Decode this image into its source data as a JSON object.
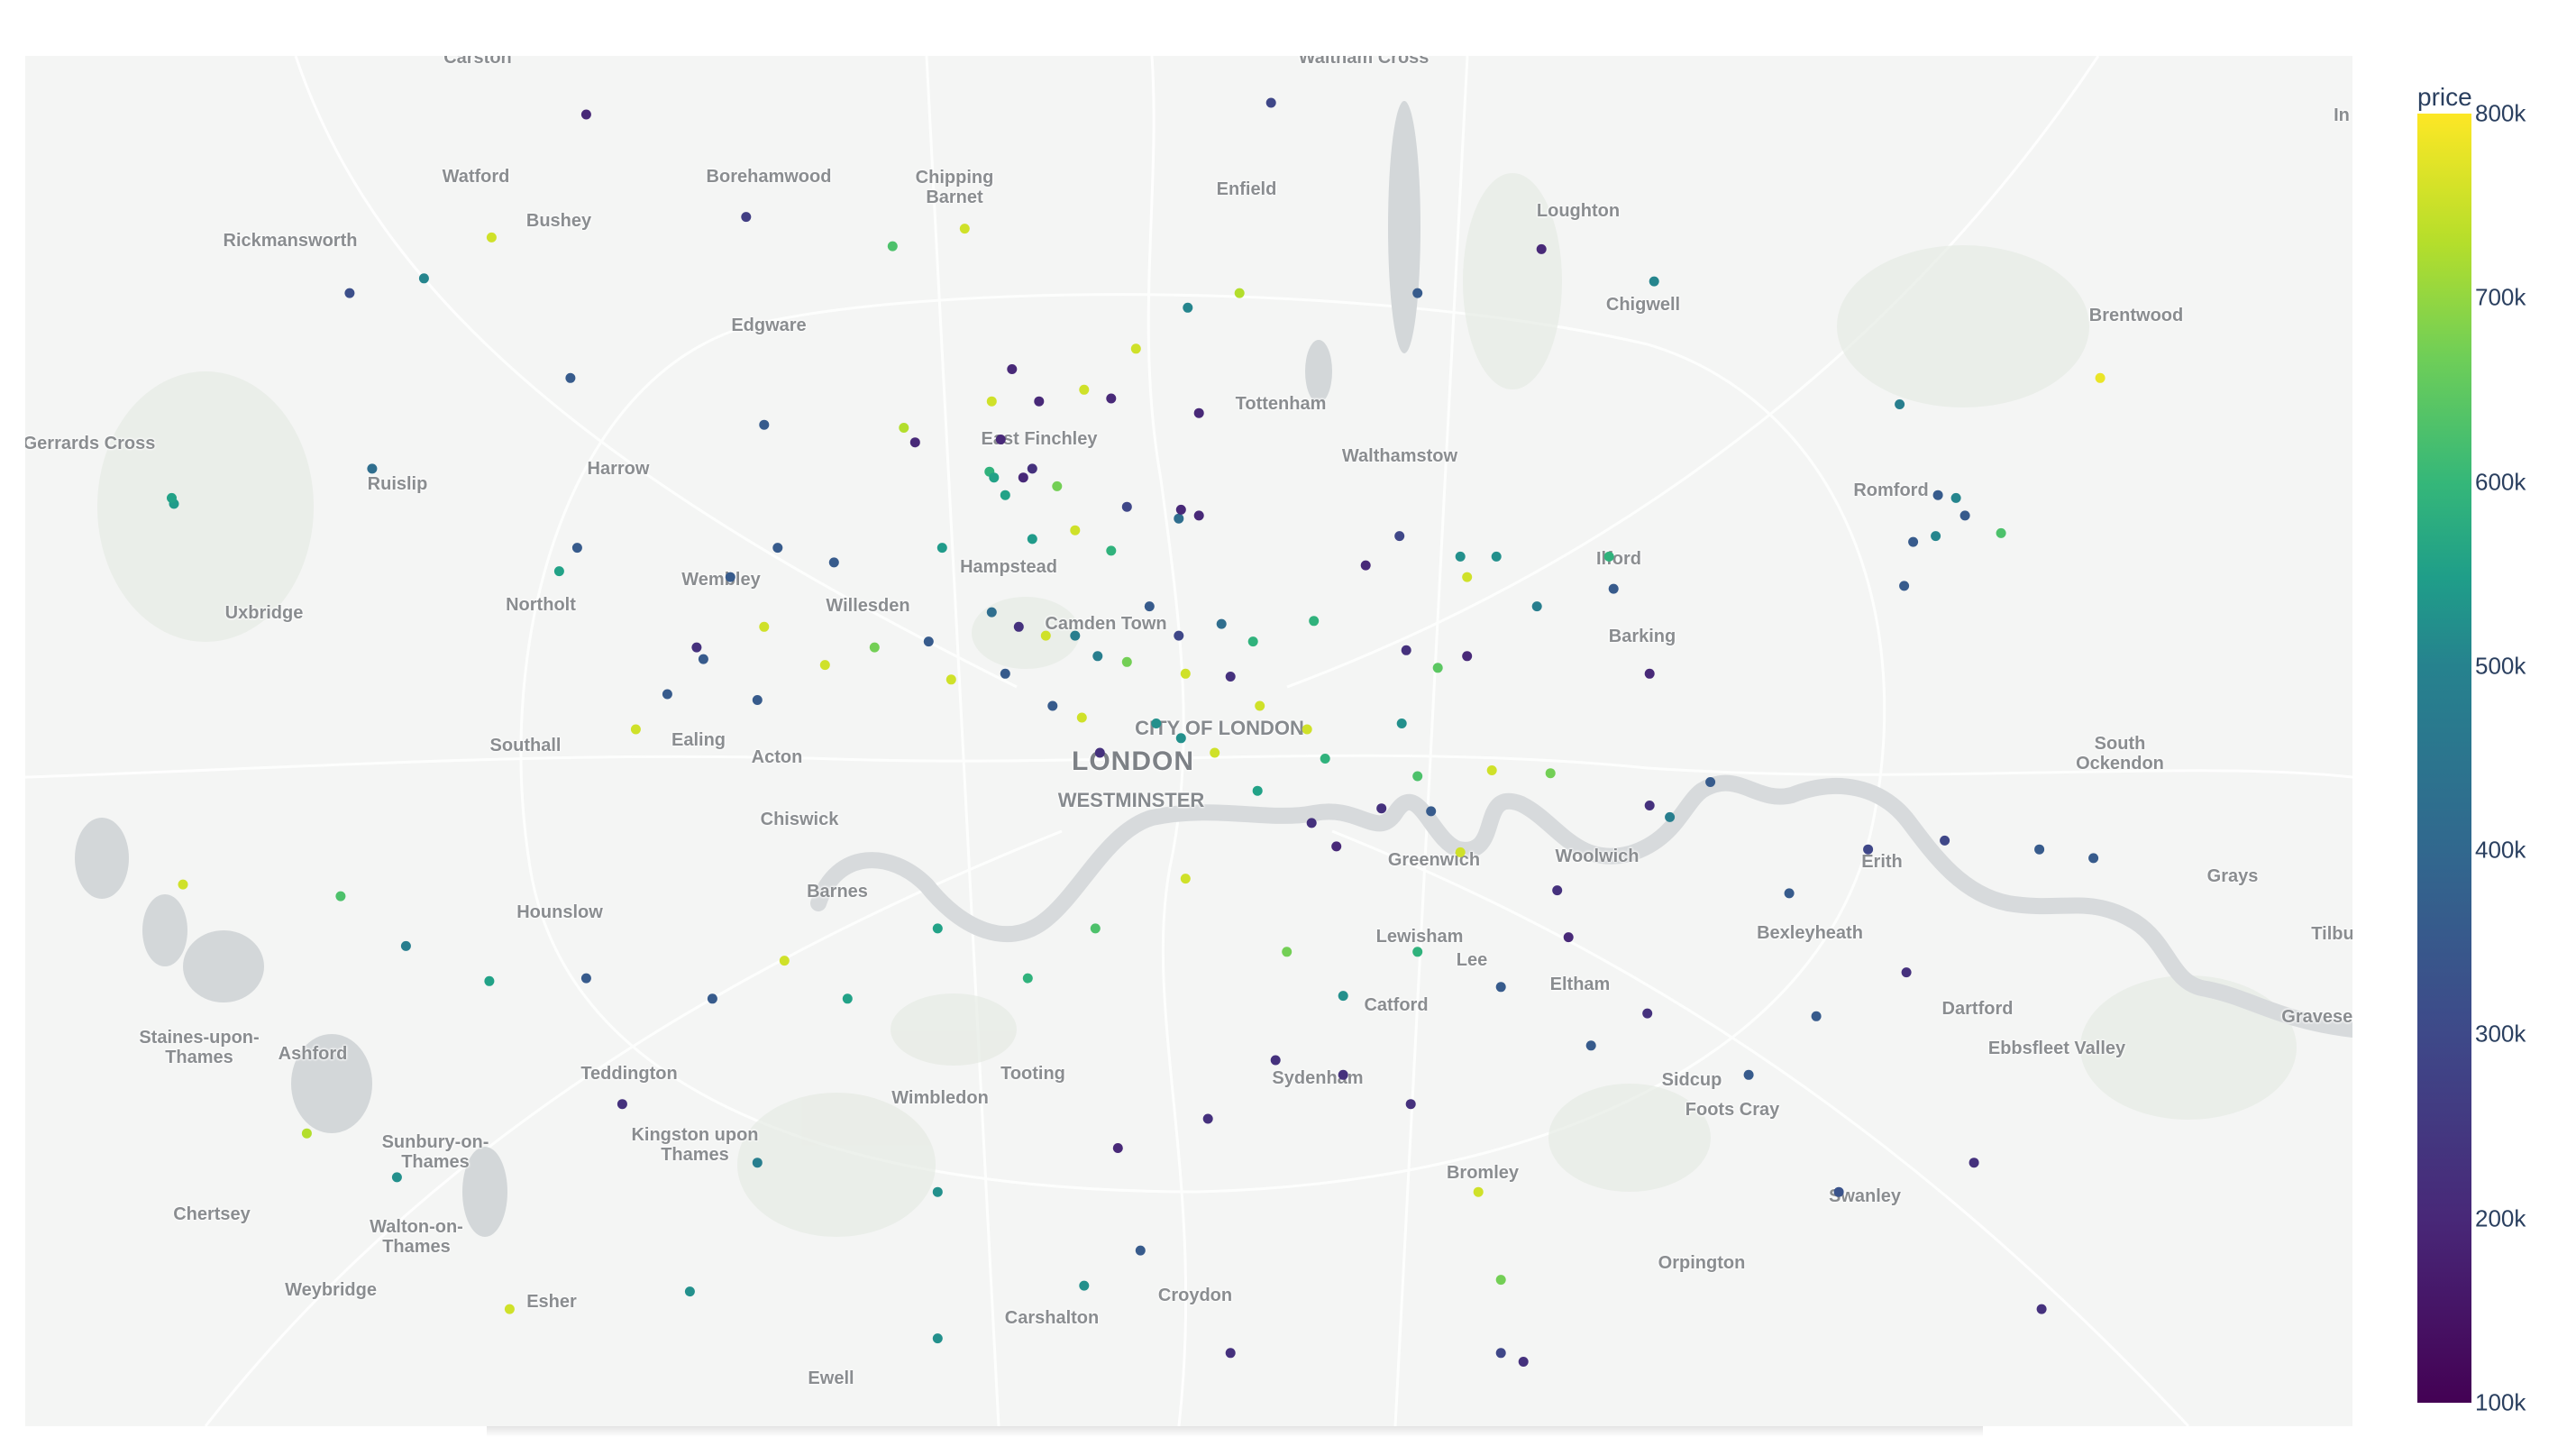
{
  "colorbar": {
    "title": "price",
    "ticks": [
      "800k",
      "700k",
      "600k",
      "500k",
      "400k",
      "300k",
      "200k",
      "100k"
    ],
    "colorscale": [
      "#440154",
      "#482878",
      "#3e4989",
      "#31688e",
      "#26828e",
      "#1f9e89",
      "#35b779",
      "#6ece58",
      "#b5de2b",
      "#fde725"
    ],
    "range": [
      100000,
      800000
    ]
  },
  "map": {
    "water_color": "#d9dcde",
    "land_color": "#f4f5f4",
    "major_label": "LONDON",
    "info_icon": "info-icon",
    "places": [
      "Carston",
      "Waltham Cross",
      "Watford",
      "Borehamwood",
      "Chipping Barnet",
      "Enfield",
      "Loughton",
      "Bushey",
      "Rickmansworth",
      "Chigwell",
      "Edgware",
      "Brentwood",
      "Tottenham",
      "Gerrards Cross",
      "East Finchley",
      "Walthamstow",
      "Romford",
      "Ruislip",
      "Harrow",
      "Hampstead",
      "Ilford",
      "Wembley",
      "Northolt",
      "Willesden",
      "Camden Town",
      "Barking",
      "Uxbridge",
      "CITY OF LONDON",
      "South Ockendon",
      "Southall",
      "Ealing",
      "Acton",
      "WESTMINSTER",
      "Chiswick",
      "Greenwich",
      "Woolwich",
      "Erith",
      "Grays",
      "Barnes",
      "Hounslow",
      "Lewisham",
      "Bexleyheath",
      "Tilbu",
      "Lee",
      "Eltham",
      "Catford",
      "Dartford",
      "Staines-upon-Thames",
      "Ashford",
      "Gravesend",
      "Ebbsfleet Valley",
      "Teddington",
      "Tooting",
      "Sydenham",
      "Sidcup",
      "Wimbledon",
      "Foots Cray",
      "Kingston upon Thames",
      "Sunbury-on-Thames",
      "Bromley",
      "Swanley",
      "Chertsey",
      "Walton-on-Thames",
      "Orpington",
      "Weybridge",
      "Esher",
      "Croydon",
      "Carshalton",
      "Ewell",
      "In"
    ]
  },
  "chart_data": {
    "type": "scatter",
    "title": "",
    "color_variable": "price",
    "color_range": [
      100000,
      800000
    ],
    "points": [
      [
        -0.356,
        51.698,
        180000
      ],
      [
        -0.052,
        51.702,
        250000
      ],
      [
        -0.285,
        51.663,
        230000
      ],
      [
        -0.398,
        51.656,
        750000
      ],
      [
        0.068,
        51.652,
        180000
      ],
      [
        -0.22,
        51.653,
        600000
      ],
      [
        -0.188,
        51.659,
        750000
      ],
      [
        -0.066,
        51.637,
        720000
      ],
      [
        -0.089,
        51.632,
        420000
      ],
      [
        0.013,
        51.637,
        300000
      ],
      [
        0.118,
        51.641,
        420000
      ],
      [
        -0.428,
        51.642,
        420000
      ],
      [
        -0.461,
        51.637,
        270000
      ],
      [
        -0.112,
        51.618,
        750000
      ],
      [
        -0.167,
        51.611,
        180000
      ],
      [
        -0.155,
        51.6,
        180000
      ],
      [
        -0.176,
        51.6,
        750000
      ],
      [
        -0.135,
        51.604,
        750000
      ],
      [
        -0.123,
        51.601,
        180000
      ],
      [
        -0.084,
        51.596,
        180000
      ],
      [
        -0.363,
        51.608,
        300000
      ],
      [
        0.316,
        51.608,
        780000
      ],
      [
        -0.21,
        51.586,
        180000
      ],
      [
        -0.172,
        51.587,
        180000
      ],
      [
        -0.215,
        51.591,
        720000
      ],
      [
        -0.277,
        51.592,
        300000
      ],
      [
        -0.177,
        51.576,
        550000
      ],
      [
        -0.175,
        51.574,
        500000
      ],
      [
        -0.17,
        51.568,
        500000
      ],
      [
        -0.162,
        51.574,
        180000
      ],
      [
        -0.158,
        51.577,
        200000
      ],
      [
        -0.147,
        51.571,
        650000
      ],
      [
        -0.139,
        51.556,
        750000
      ],
      [
        -0.116,
        51.564,
        250000
      ],
      [
        -0.123,
        51.549,
        550000
      ],
      [
        -0.093,
        51.56,
        350000
      ],
      [
        -0.084,
        51.561,
        180000
      ],
      [
        -0.092,
        51.563,
        180000
      ],
      [
        0.227,
        51.599,
        400000
      ],
      [
        0.244,
        51.568,
        300000
      ],
      [
        0.252,
        51.567,
        420000
      ],
      [
        0.256,
        51.561,
        300000
      ],
      [
        0.243,
        51.554,
        420000
      ],
      [
        0.233,
        51.552,
        300000
      ],
      [
        0.229,
        51.537,
        300000
      ],
      [
        0.272,
        51.555,
        600000
      ],
      [
        -0.539,
        51.565,
        480000
      ],
      [
        -0.54,
        51.567,
        500000
      ],
      [
        -0.451,
        51.577,
        350000
      ],
      [
        -0.36,
        51.55,
        300000
      ],
      [
        -0.368,
        51.542,
        500000
      ],
      [
        -0.292,
        51.54,
        300000
      ],
      [
        -0.271,
        51.55,
        300000
      ],
      [
        -0.246,
        51.545,
        300000
      ],
      [
        -0.198,
        51.55,
        480000
      ],
      [
        -0.158,
        51.553,
        480000
      ],
      [
        -0.152,
        51.52,
        750000
      ],
      [
        -0.106,
        51.53,
        300000
      ],
      [
        -0.074,
        51.524,
        350000
      ],
      [
        -0.06,
        51.518,
        550000
      ],
      [
        -0.033,
        51.525,
        550000
      ],
      [
        -0.01,
        51.544,
        180000
      ],
      [
        0.008,
        51.515,
        200000
      ],
      [
        0.022,
        51.509,
        620000
      ],
      [
        0.035,
        51.513,
        180000
      ],
      [
        0.035,
        51.54,
        750000
      ],
      [
        0.005,
        51.554,
        250000
      ],
      [
        0.032,
        51.547,
        450000
      ],
      [
        0.048,
        51.547,
        450000
      ],
      [
        0.066,
        51.53,
        400000
      ],
      [
        0.1,
        51.536,
        300000
      ],
      [
        0.116,
        51.507,
        180000
      ],
      [
        0.098,
        51.547,
        550000
      ],
      [
        -0.176,
        51.528,
        350000
      ],
      [
        -0.164,
        51.523,
        200000
      ],
      [
        -0.139,
        51.52,
        400000
      ],
      [
        -0.129,
        51.513,
        400000
      ],
      [
        -0.116,
        51.511,
        650000
      ],
      [
        -0.09,
        51.507,
        750000
      ],
      [
        -0.07,
        51.506,
        200000
      ],
      [
        -0.093,
        51.52,
        250000
      ],
      [
        -0.057,
        51.496,
        750000
      ],
      [
        -0.036,
        51.488,
        750000
      ],
      [
        -0.028,
        51.478,
        550000
      ],
      [
        0.006,
        51.49,
        450000
      ],
      [
        0.013,
        51.472,
        600000
      ],
      [
        0.046,
        51.474,
        750000
      ],
      [
        0.072,
        51.473,
        650000
      ],
      [
        0.116,
        51.462,
        200000
      ],
      [
        0.143,
        51.47,
        300000
      ],
      [
        -0.277,
        51.523,
        750000
      ],
      [
        -0.304,
        51.512,
        300000
      ],
      [
        -0.32,
        51.5,
        300000
      ],
      [
        -0.334,
        51.488,
        750000
      ],
      [
        -0.307,
        51.516,
        200000
      ],
      [
        -0.28,
        51.498,
        300000
      ],
      [
        -0.25,
        51.51,
        750000
      ],
      [
        -0.228,
        51.516,
        650000
      ],
      [
        -0.204,
        51.518,
        300000
      ],
      [
        -0.194,
        51.505,
        750000
      ],
      [
        -0.17,
        51.507,
        300000
      ],
      [
        -0.149,
        51.496,
        300000
      ],
      [
        -0.136,
        51.492,
        750000
      ],
      [
        -0.128,
        51.48,
        200000
      ],
      [
        -0.103,
        51.49,
        450000
      ],
      [
        -0.092,
        51.485,
        450000
      ],
      [
        -0.077,
        51.48,
        750000
      ],
      [
        -0.058,
        51.467,
        500000
      ],
      [
        -0.034,
        51.456,
        200000
      ],
      [
        -0.023,
        51.448,
        180000
      ],
      [
        -0.003,
        51.461,
        200000
      ],
      [
        0.019,
        51.46,
        300000
      ],
      [
        0.032,
        51.446,
        750000
      ],
      [
        0.075,
        51.433,
        200000
      ],
      [
        0.125,
        51.458,
        400000
      ],
      [
        0.178,
        51.432,
        300000
      ],
      [
        0.213,
        51.447,
        250000
      ],
      [
        0.247,
        51.45,
        250000
      ],
      [
        0.289,
        51.447,
        300000
      ],
      [
        0.313,
        51.444,
        300000
      ],
      [
        -0.535,
        51.435,
        750000
      ],
      [
        -0.465,
        51.431,
        600000
      ],
      [
        -0.436,
        51.414,
        400000
      ],
      [
        -0.399,
        51.402,
        500000
      ],
      [
        -0.356,
        51.403,
        300000
      ],
      [
        -0.3,
        51.396,
        300000
      ],
      [
        -0.268,
        51.409,
        750000
      ],
      [
        -0.24,
        51.396,
        500000
      ],
      [
        -0.2,
        51.42,
        500000
      ],
      [
        -0.16,
        51.403,
        550000
      ],
      [
        -0.13,
        51.42,
        600000
      ],
      [
        -0.09,
        51.437,
        750000
      ],
      [
        -0.045,
        51.412,
        650000
      ],
      [
        -0.02,
        51.397,
        450000
      ],
      [
        0.013,
        51.412,
        550000
      ],
      [
        0.05,
        51.4,
        300000
      ],
      [
        0.08,
        51.417,
        180000
      ],
      [
        0.115,
        51.391,
        200000
      ],
      [
        -0.48,
        51.35,
        720000
      ],
      [
        -0.44,
        51.335,
        450000
      ],
      [
        -0.34,
        51.36,
        200000
      ],
      [
        -0.28,
        51.34,
        400000
      ],
      [
        -0.2,
        51.33,
        450000
      ],
      [
        -0.12,
        51.345,
        180000
      ],
      [
        -0.08,
        51.355,
        200000
      ],
      [
        -0.05,
        51.375,
        200000
      ],
      [
        -0.02,
        51.37,
        200000
      ],
      [
        0.01,
        51.36,
        200000
      ],
      [
        0.04,
        51.33,
        750000
      ],
      [
        0.09,
        51.38,
        300000
      ],
      [
        0.16,
        51.37,
        300000
      ],
      [
        0.2,
        51.33,
        280000
      ],
      [
        0.26,
        51.34,
        200000
      ],
      [
        0.29,
        51.29,
        200000
      ],
      [
        -0.39,
        51.29,
        750000
      ],
      [
        -0.31,
        51.296,
        450000
      ],
      [
        -0.2,
        51.28,
        450000
      ],
      [
        -0.135,
        51.298,
        450000
      ],
      [
        -0.11,
        51.31,
        300000
      ],
      [
        -0.07,
        51.275,
        200000
      ],
      [
        0.05,
        51.3,
        650000
      ],
      [
        0.05,
        51.275,
        250000
      ],
      [
        0.06,
        51.272,
        200000
      ],
      [
        0.19,
        51.39,
        300000
      ],
      [
        0.23,
        51.405,
        200000
      ]
    ]
  }
}
